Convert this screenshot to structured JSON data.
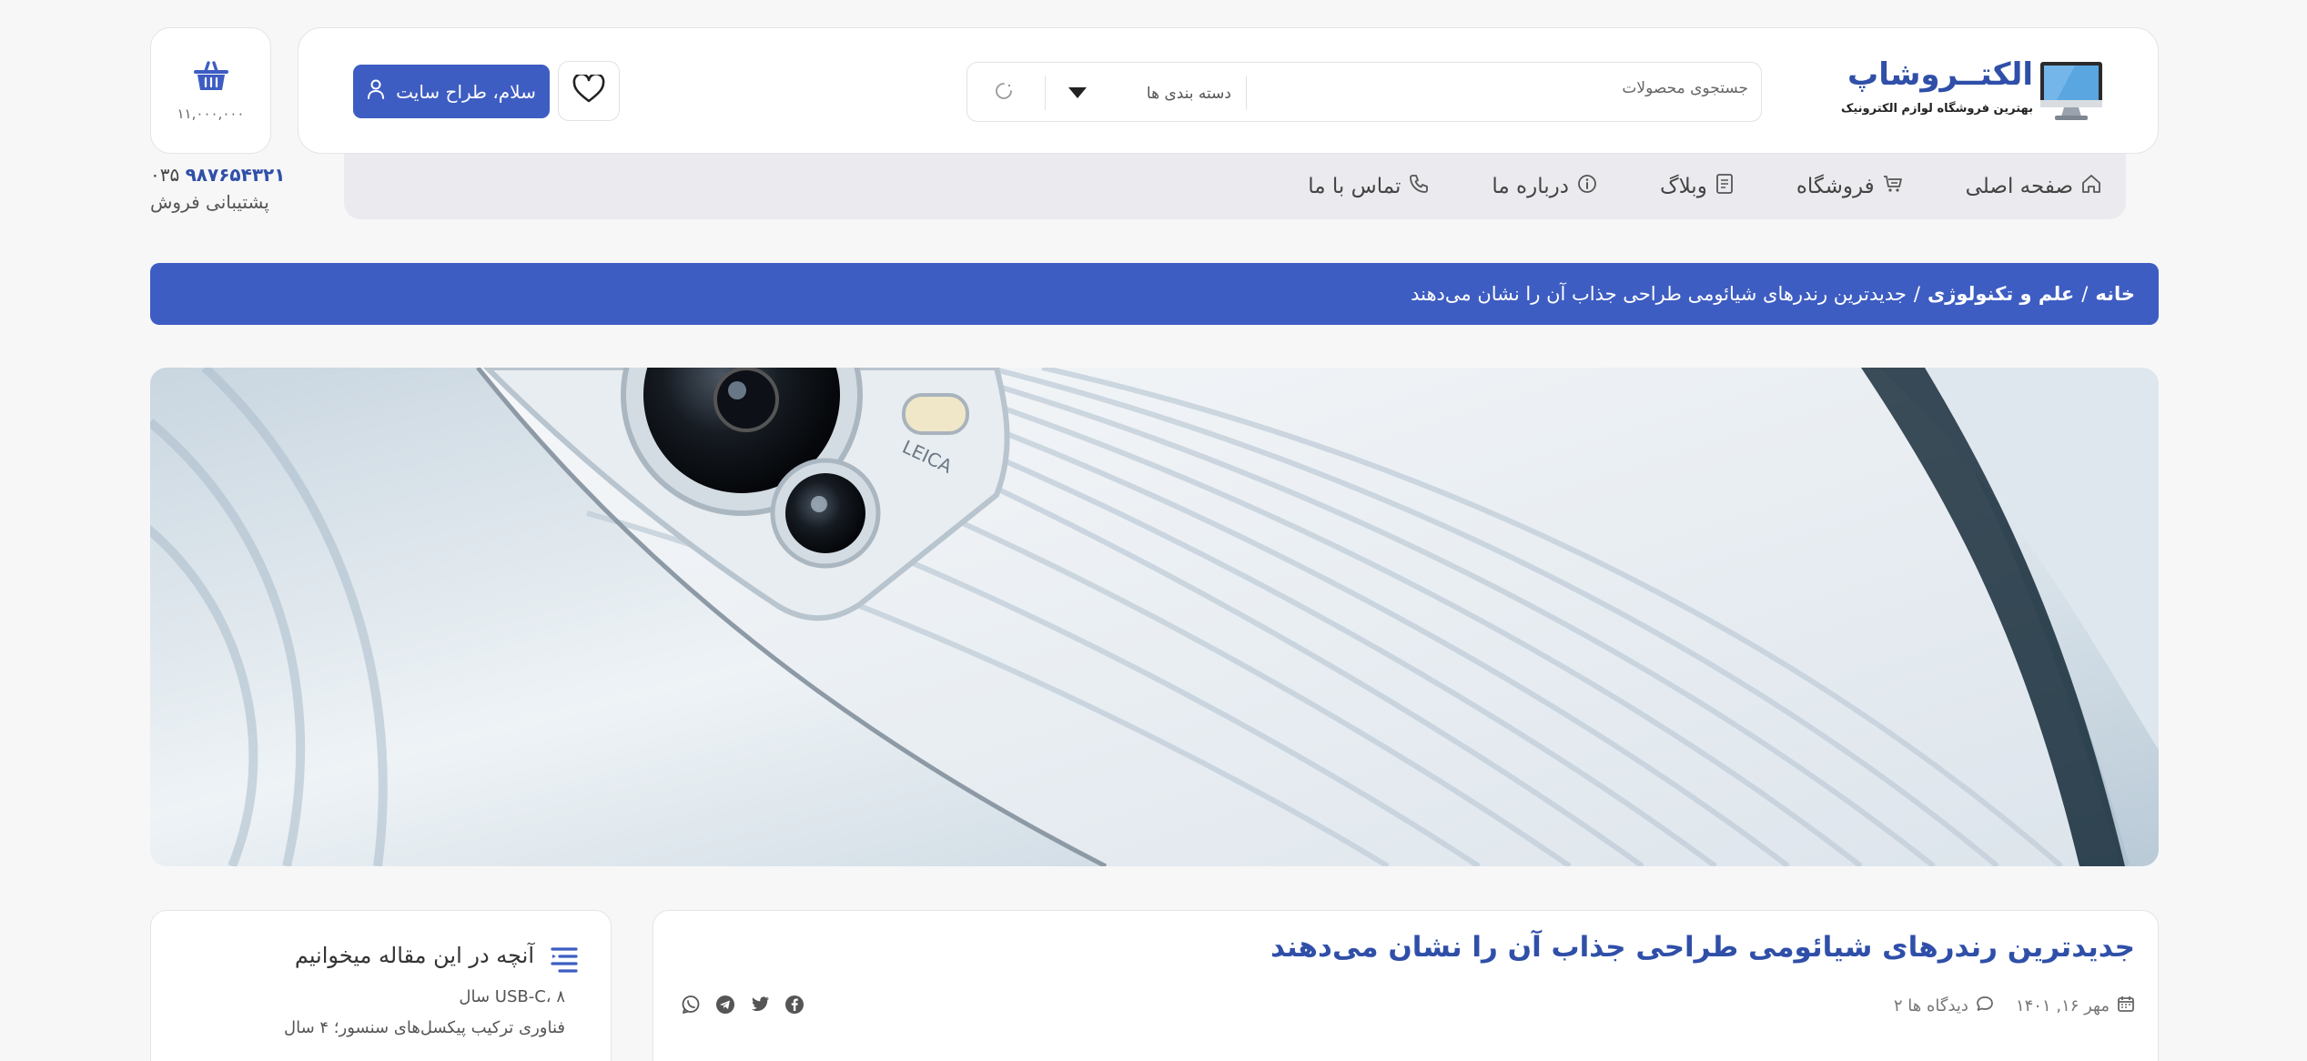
{
  "header": {
    "logo": {
      "title": "الکتــروشاپ",
      "subtitle": "بهترین فروشگاه لوازم الکترونیک"
    },
    "search": {
      "placeholder": "جستجوی محصولات",
      "category_label": "دسته بندی ها"
    },
    "login_label": "سلام، طراح سایت",
    "cart_amount": "۱۱,۰۰۰,۰۰۰",
    "support": {
      "code": "۰۳۵",
      "phone": "۹۸۷۶۵۴۳۲۱",
      "label": "پشتیبانی فروش"
    }
  },
  "nav": {
    "items": [
      {
        "label": "صفحه اصلی",
        "icon": "home-icon"
      },
      {
        "label": "فروشگاه",
        "icon": "shop-cart-icon"
      },
      {
        "label": "وبلاگ",
        "icon": "blog-icon"
      },
      {
        "label": "درباره ما",
        "icon": "info-icon"
      },
      {
        "label": "تماس با ما",
        "icon": "phone-icon"
      }
    ]
  },
  "breadcrumb": {
    "home": "خانه",
    "sep1": "/",
    "category": "علم و تکنولوژی",
    "sep2": "/",
    "current": "جدیدترین رندرهای شیائومی طراحی جذاب آن را نشان می‌دهند"
  },
  "toc": {
    "title": "آنچه در این مقاله میخوانیم",
    "items": [
      "USB-C، ۸ سال",
      "فناوری ترکیب پیکسل‌های سنسور؛ ۴ سال"
    ]
  },
  "article": {
    "title": "جدیدترین رندرهای شیائومی طراحی جذاب آن را نشان می‌دهند",
    "date": "مهر ۱۶, ۱۴۰۱",
    "views": "۲ دیدگاه ها"
  },
  "colors": {
    "brand": "#3e5dc2",
    "brand_text": "#2f4fa8"
  }
}
